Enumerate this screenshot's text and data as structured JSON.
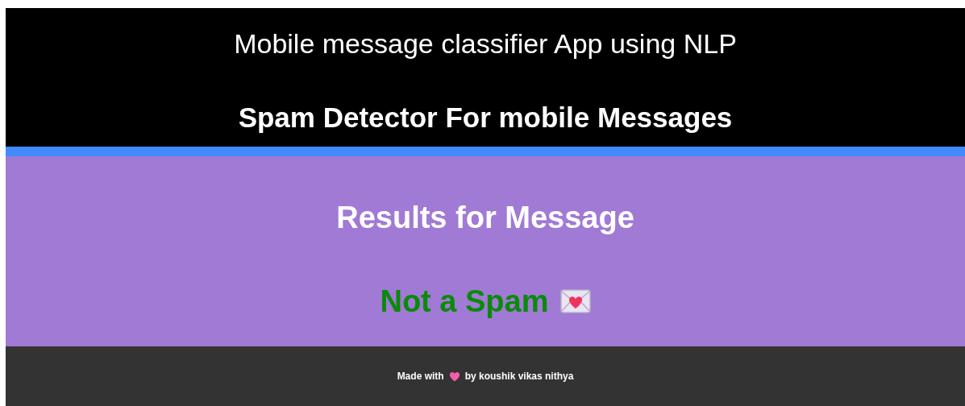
{
  "header": {
    "title": "Mobile message classifier App using NLP",
    "subtitle": "Spam Detector For mobile Messages"
  },
  "results": {
    "heading": "Results for Message",
    "verdict": "Not a Spam",
    "is_spam": false
  },
  "footer": {
    "before": "Made with",
    "after": "by koushik vikas nithya"
  }
}
